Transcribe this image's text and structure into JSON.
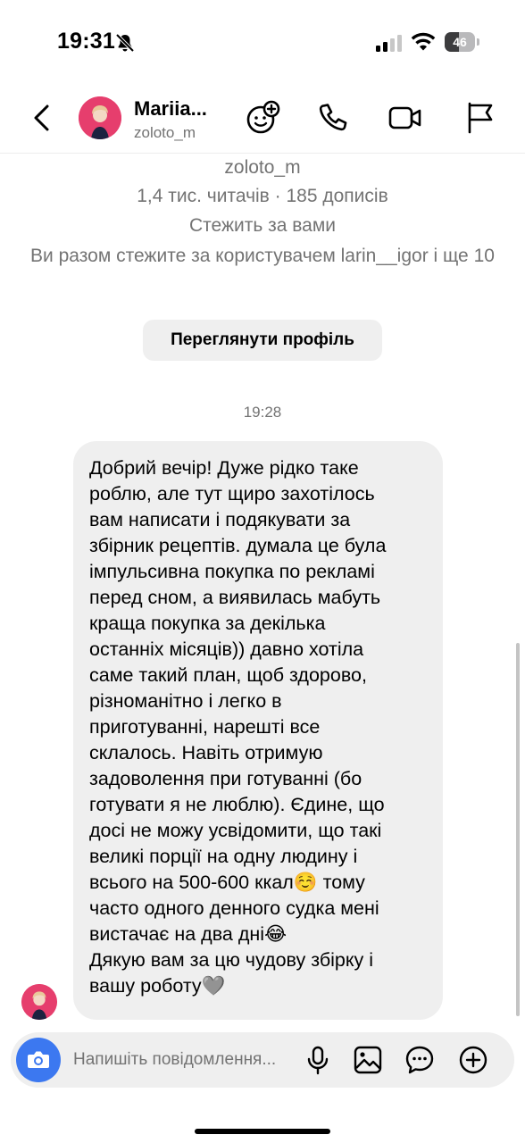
{
  "status_bar": {
    "time": "19:31",
    "battery_level": "46",
    "battery_fraction": 0.46
  },
  "header": {
    "name": "Mariia...",
    "username": "zoloto_m"
  },
  "profile": {
    "username": "zoloto_m",
    "stats": "1,4 тис. читачів · 185 дописів",
    "follows_you": "Стежить за вами",
    "mutual": "Ви разом стежите за користувачем larin__igor і ще 10",
    "view_profile_label": "Переглянути профіль"
  },
  "message": {
    "time": "19:28",
    "text": "Добрий вечір! Дуже рідко таке\nроблю, але тут щиро захотілось\nвам написати і подякувати за\nзбірник рецептів. думала це була\nімпульсивна покупка по рекламі\nперед сном, а виявилась мабуть\nкраща покупка за декілька\nостанніх місяців)) давно хотіла\nсаме такий план, щоб здорово,\nрізноманітно і легко в\nприготуванні, нарешті все\nсклалось. Навіть отримую\nзадоволення при готуванні (бо\nготувати я не люблю). Єдине, що\nдосі не можу усвідомити, що такі\nвеликі порції на одну людину і\nвсього на 500-600 ккал☺️ тому\nчасто одного денного судка мені\nвистачає на два дні😂\nДякую вам за цю чудову збірку і\nвашу роботу🩶"
  },
  "composer": {
    "placeholder": "Напишіть повідомлення..."
  },
  "colors": {
    "accent": "#3c78f0",
    "bubble": "#efefef",
    "secondary_text": "#737373",
    "avatar": "#e63e6d"
  },
  "icons": [
    "bell-slash-icon",
    "signal-icon",
    "wifi-icon",
    "back-chevron-icon",
    "sticker-face-icon",
    "phone-icon",
    "video-camera-icon",
    "flag-icon",
    "camera-icon",
    "microphone-icon",
    "image-icon",
    "chat-bubble-icon",
    "plus-circle-icon"
  ]
}
